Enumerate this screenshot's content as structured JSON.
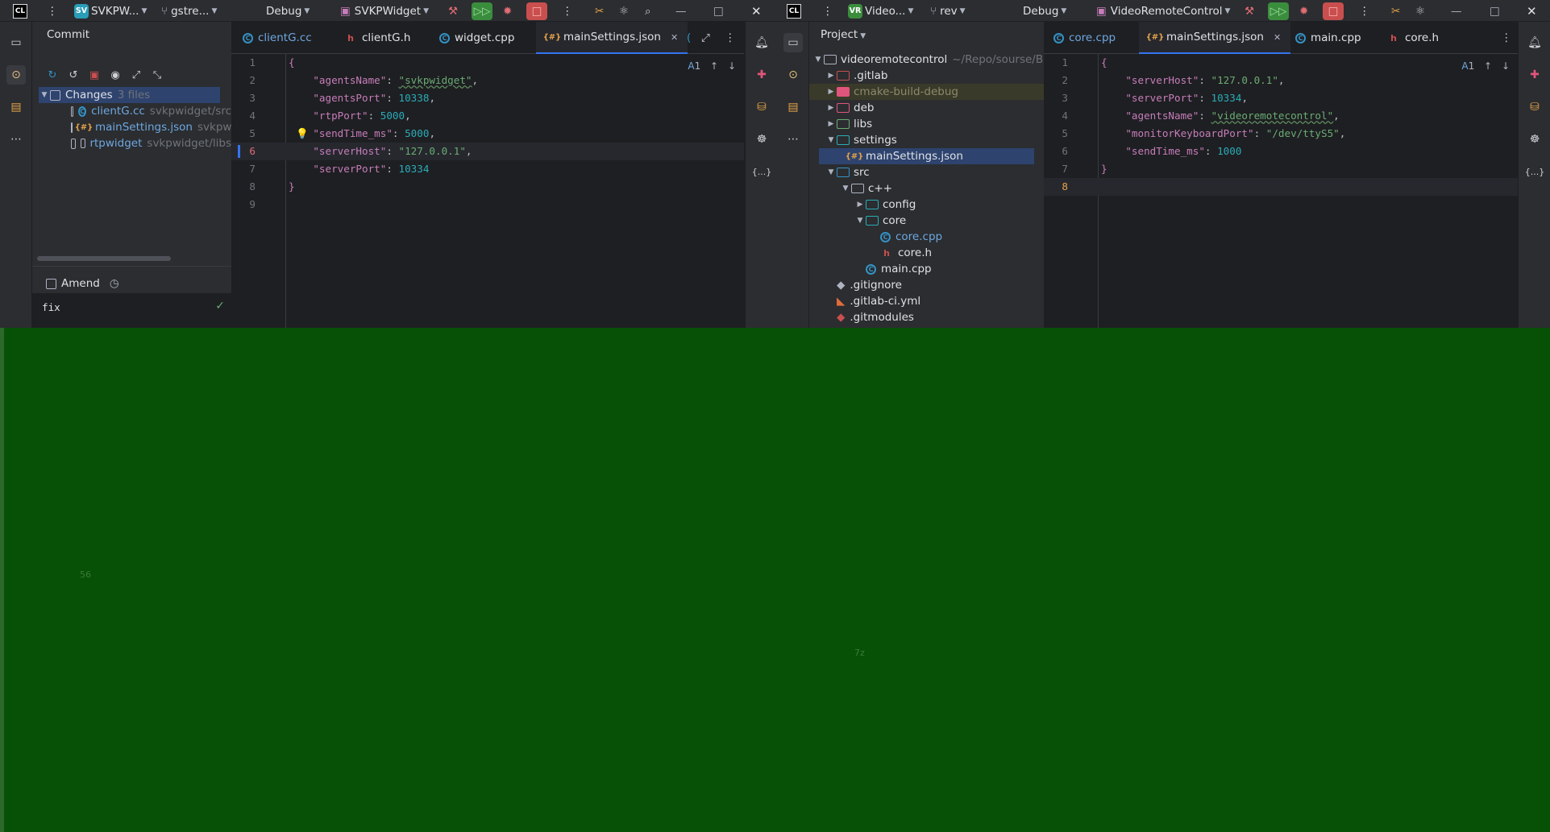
{
  "left": {
    "logo": "CL",
    "project_badge": "SV",
    "project_badge_color": "#2a9db8",
    "project": "SVKPW...",
    "branch": "gstre...",
    "build_config": "Debug",
    "run_config": "SVKPWidget",
    "commit_panel": {
      "title": "Commit",
      "changes_label": "Changes",
      "changes_count": "3 files",
      "files": [
        {
          "name": "clientG.cc",
          "path": "svkpwidget/src",
          "icon": "cpp-file-icon"
        },
        {
          "name": "mainSettings.json",
          "path": "svkpwi",
          "icon": "json-file-icon"
        },
        {
          "name": "rtpwidget",
          "path": "svkpwidget/libs",
          "icon": "folder-icon"
        }
      ],
      "amend_label": "Amend",
      "message": "fix"
    },
    "tabs": [
      {
        "label": "clientG.cc",
        "icon": "cpp"
      },
      {
        "label": "clientG.h",
        "icon": "h"
      },
      {
        "label": "widget.cpp",
        "icon": "cpp"
      },
      {
        "label": "mainSettings.json",
        "icon": "json",
        "active": true
      }
    ],
    "inspection_count": "1",
    "code_lines": [
      "{",
      "agentsName",
      "agentsPort",
      "rtpPort",
      "sendTime_ms",
      "serverHost",
      "serverPort",
      "}",
      ""
    ],
    "json": {
      "agentsName": {
        "key": "\"agentsName\"",
        "value": "\"svkpwidget\""
      },
      "agentsPort": {
        "key": "\"agentsPort\"",
        "value": "10338"
      },
      "rtpPort": {
        "key": "\"rtpPort\"",
        "value": "5000"
      },
      "sendTime_ms": {
        "key": "\"sendTime_ms\"",
        "value": "5000"
      },
      "serverHost": {
        "key": "\"serverHost\"",
        "value": "\"127.0.0.1\""
      },
      "serverPort": {
        "key": "\"serverPort\"",
        "value": "10334"
      }
    }
  },
  "right": {
    "logo": "CL",
    "project_badge": "VR",
    "project_badge_color": "#3b8d3e",
    "project": "Video...",
    "branch": "rev",
    "build_config": "Debug",
    "run_config": "VideoRemoteControl",
    "project_panel": {
      "title": "Project",
      "root": "videoremotecontrol",
      "root_path": "~/Repo/sourse/B",
      "items": [
        {
          "label": ".gitlab"
        },
        {
          "label": "cmake-build-debug"
        },
        {
          "label": "deb"
        },
        {
          "label": "libs"
        },
        {
          "label": "settings"
        },
        {
          "label": "mainSettings.json"
        },
        {
          "label": "src"
        },
        {
          "label": "c++"
        },
        {
          "label": "config"
        },
        {
          "label": "core"
        },
        {
          "label": "core.cpp"
        },
        {
          "label": "core.h"
        },
        {
          "label": "main.cpp"
        },
        {
          "label": ".gitignore"
        },
        {
          "label": ".gitlab-ci.yml"
        },
        {
          "label": ".gitmodules"
        }
      ]
    },
    "tabs": [
      {
        "label": "core.cpp",
        "icon": "cpp"
      },
      {
        "label": "mainSettings.json",
        "icon": "json",
        "active": true
      },
      {
        "label": "main.cpp",
        "icon": "cpp"
      },
      {
        "label": "core.h",
        "icon": "h"
      }
    ],
    "inspection_count": "1",
    "json": {
      "serverHost": {
        "key": "\"serverHost\"",
        "value": "\"127.0.0.1\""
      },
      "serverPort": {
        "key": "\"serverPort\"",
        "value": "10334"
      },
      "agentsName": {
        "key": "\"agentsName\"",
        "value": "\"videoremotecontrol\""
      },
      "monitorKeyboardPort": {
        "key": "\"monitorKeyboardPort\"",
        "value": "\"/dev/ttyS5\""
      },
      "sendTime_ms": {
        "key": "\"sendTime_ms\"",
        "value": "1000"
      }
    }
  },
  "background": {
    "label_a": "56",
    "label_b": "7z"
  }
}
